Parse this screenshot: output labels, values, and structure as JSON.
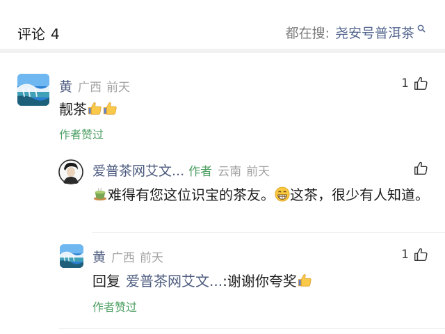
{
  "header": {
    "title": "评论",
    "count": "4",
    "search_prefix": "都在搜:",
    "search_term": "尧安号普洱茶"
  },
  "comments": [
    {
      "user": "黄",
      "region": "广西",
      "time": "前天",
      "like_count": "1",
      "text": "靓茶",
      "approved_label": "作者赞过",
      "avatar_icon": "landscape-avatar",
      "emojis": [
        "thumbs-up-icon",
        "thumbs-up-icon"
      ]
    },
    {
      "user": "爱普茶网艾文...",
      "badge": "作者",
      "region": "云南",
      "time": "前天",
      "like_count": "",
      "text_before": "难得有您这位识宝的茶友。",
      "text_after": "这茶，很少有人知道。",
      "avatar_icon": "portrait-avatar",
      "emojis": [
        "tea-icon",
        "grin-emoji-icon"
      ]
    },
    {
      "user": "黄",
      "region": "广西",
      "time": "前天",
      "like_count": "1",
      "reply_prefix": "回复",
      "reply_to": "爱普茶网艾文...",
      "text": ":谢谢你夸奖",
      "approved_label": "作者赞过",
      "avatar_icon": "landscape-avatar",
      "emojis": [
        "thumbs-up-icon"
      ]
    }
  ],
  "colors": {
    "name": "#4b5a7e",
    "author_green": "#4d9f63",
    "meta_gray": "#a3a3a3",
    "search_link": "#55678f"
  }
}
